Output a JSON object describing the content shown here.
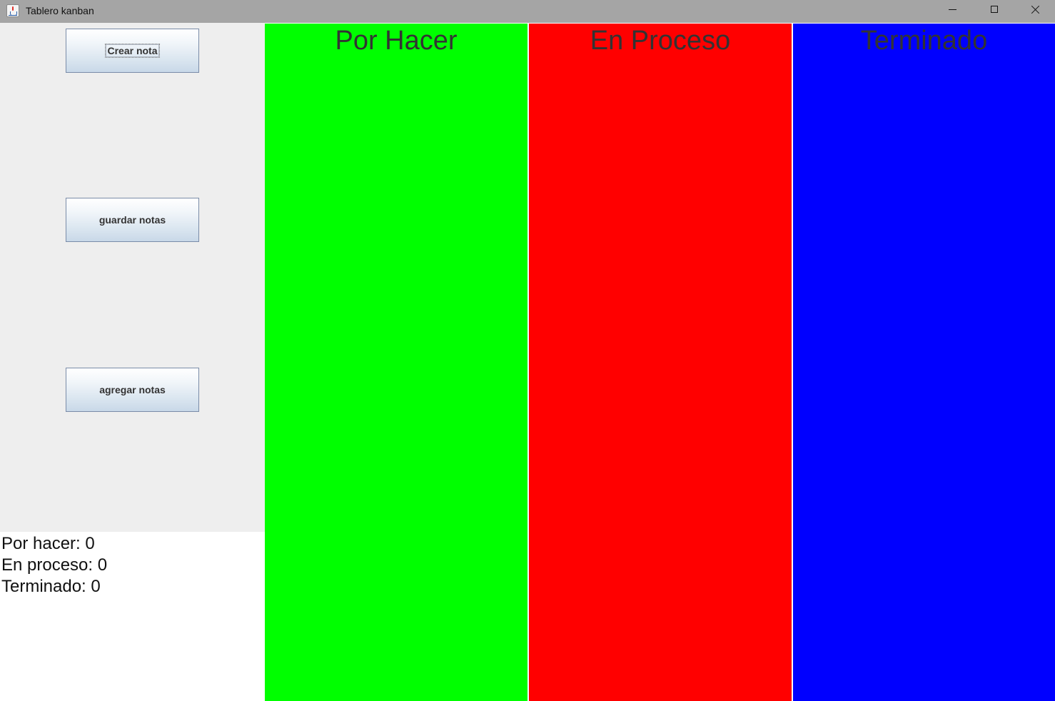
{
  "window": {
    "title": "Tablero kanban",
    "controls": {
      "minimize": "minimize-icon",
      "maximize": "maximize-icon",
      "close": "close-icon"
    }
  },
  "sidebar": {
    "buttons": {
      "create": "Crear nota",
      "save": "guardar notas",
      "add": "agregar notas"
    },
    "counters": {
      "todo": "Por hacer: 0",
      "in_progress": "En proceso: 0",
      "done": "Terminado: 0"
    }
  },
  "board": {
    "columns": [
      {
        "title": "Por Hacer",
        "color": "#00ff00"
      },
      {
        "title": "En Proceso",
        "color": "#ff0000"
      },
      {
        "title": "Terminado",
        "color": "#0000ff"
      }
    ]
  }
}
